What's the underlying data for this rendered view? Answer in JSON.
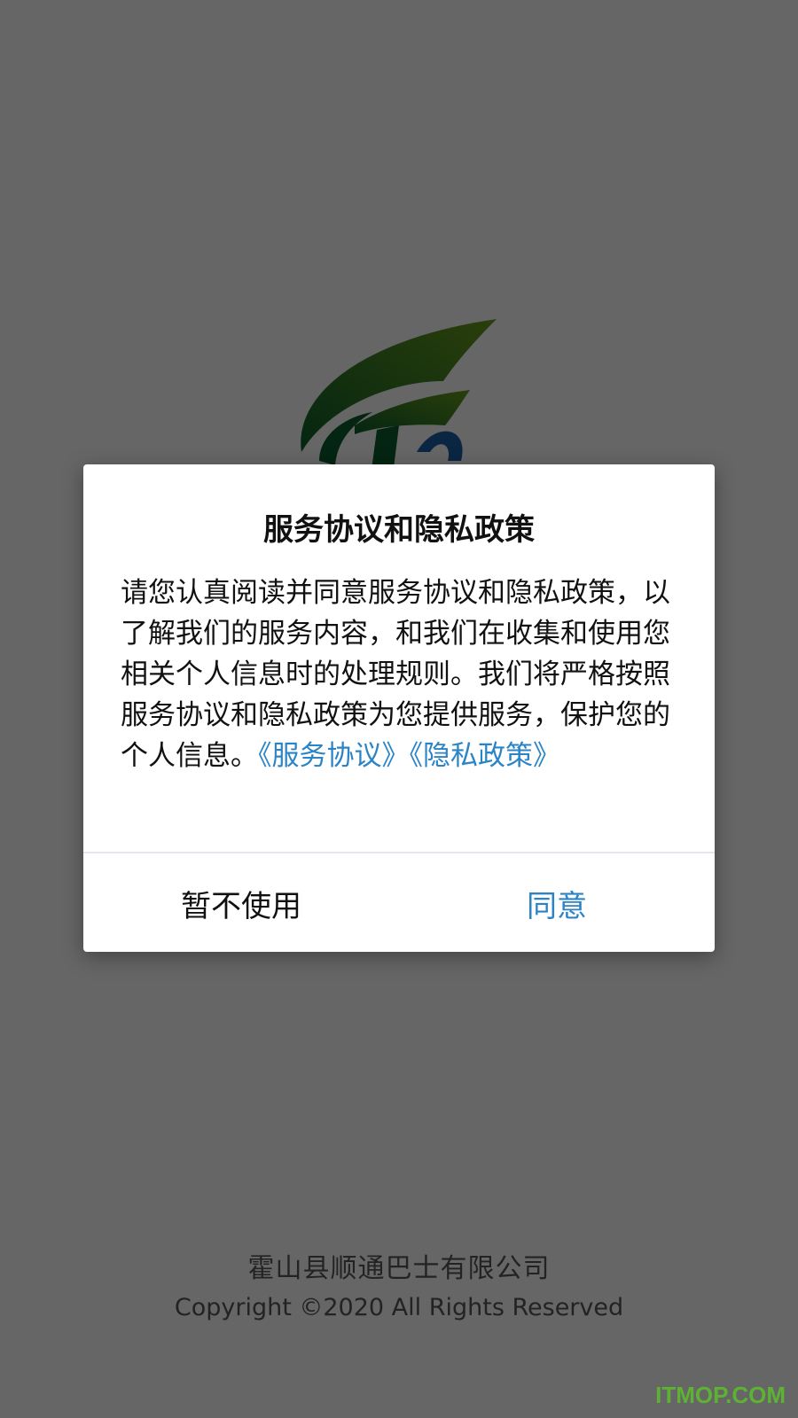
{
  "dialog": {
    "title": "服务协议和隐私政策",
    "body": "请您认真阅读并同意服务协议和隐私政策，以了解我们的服务内容，和我们在收集和使用您相关个人信息时的处理规则。我们将严格按照服务协议和隐私政策为您提供服务，保护您的个人信息。",
    "service_agreement_link": "《服务协议》",
    "privacy_policy_link": "《隐私政策》",
    "cancel_label": "暂不使用",
    "agree_label": "同意"
  },
  "footer": {
    "company": "霍山县顺通巴士有限公司",
    "copyright": "Copyright ©2020  All Rights Reserved"
  },
  "watermark": "ITMOP.COM",
  "colors": {
    "link": "#2b84c6",
    "logo_green_dark": "#0b5e2b",
    "logo_green_light": "#6a9d1c",
    "logo_blue": "#1d5fa8",
    "watermark": "#5dbb2e"
  },
  "icons": {
    "logo": "app-logo"
  }
}
